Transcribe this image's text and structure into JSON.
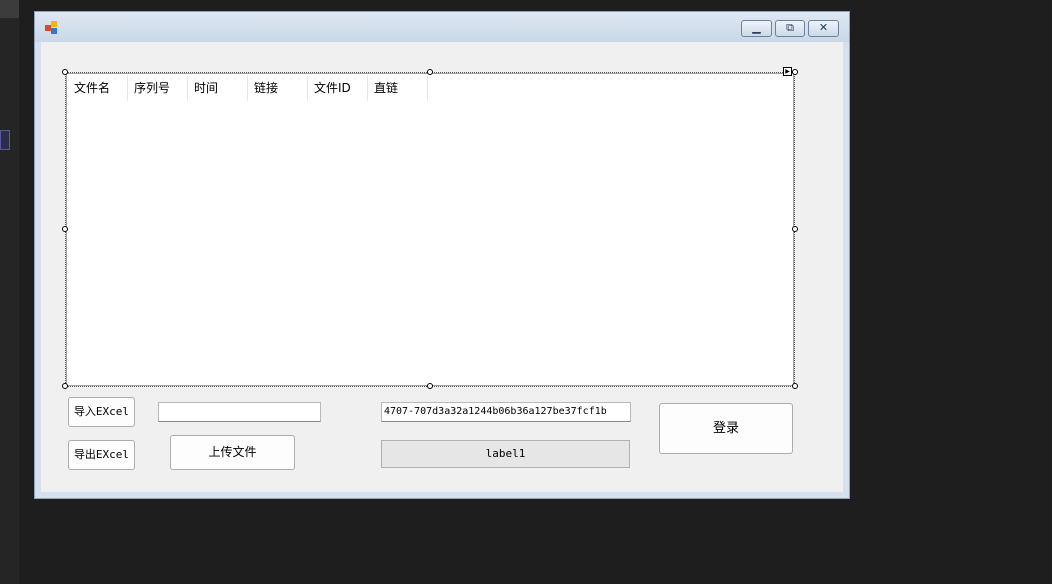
{
  "listview": {
    "columns": [
      "文件名",
      "序列号",
      "时间",
      "链接",
      "文件ID",
      "直链"
    ]
  },
  "buttons": {
    "import_excel": "导入EXcel",
    "export_excel": "导出EXcel",
    "upload_file": "上传文件",
    "login": "登录"
  },
  "inputs": {
    "path_value": "",
    "key_value": "4707-707d3a32a1244b06b36a127be37fcf1b"
  },
  "status_label": "label1",
  "icons": {
    "app": "app-icon",
    "minimize": "minimize-icon",
    "maximize": "maximize-icon",
    "close": "close-icon",
    "smart_tag": "smart-tag-arrow-icon"
  },
  "colors": {
    "ide_background": "#1e1e1e",
    "title_bar": "#d5e1ef",
    "client": "#f0f0f0",
    "label_background": "#e6e6e6"
  }
}
